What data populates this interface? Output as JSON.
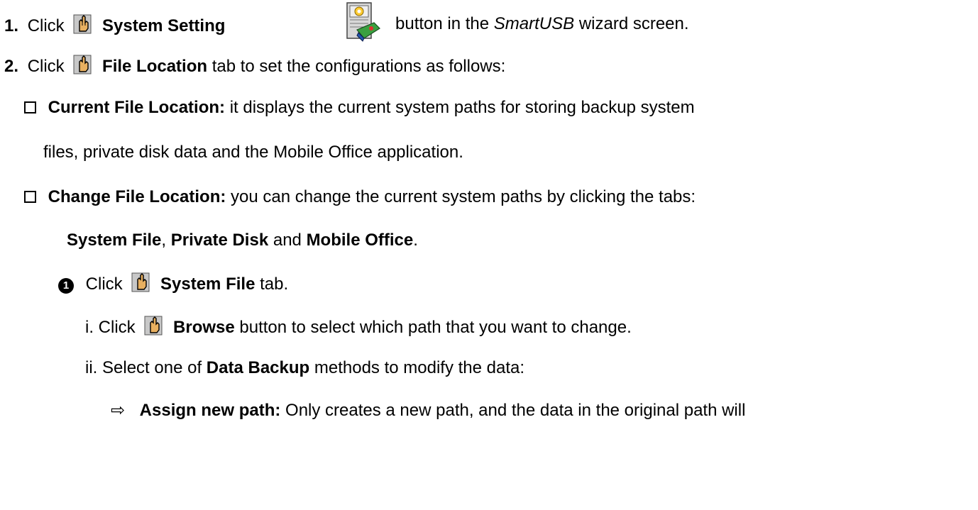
{
  "step1": {
    "num": "1.",
    "click": "Click",
    "bold": "System Setting",
    "rest1": "button in the",
    "italic": "SmartUSB",
    "rest2": "wizard screen."
  },
  "step2": {
    "num": "2.",
    "click": "Click",
    "bold": "File Location",
    "rest": "tab to set the configurations as follows:"
  },
  "current": {
    "bold": "Current File Location:",
    "text1": "it displays the current system paths for storing backup system",
    "text2": "files, private disk data and the Mobile Office application."
  },
  "change": {
    "bold": "Change File Location:",
    "text1": "you can change the current system paths by clicking the tabs:",
    "tab1": "System File",
    "sep1": ",",
    "tab2": "Private Disk",
    "and": "and",
    "tab3": "Mobile Office",
    "end": "."
  },
  "sub1": {
    "marker": "1",
    "click": "Click",
    "bold": "System File",
    "rest": "tab."
  },
  "roman1": {
    "num": "i.",
    "click": "Click",
    "bold": "Browse",
    "rest": "button to select which path that you want to change."
  },
  "roman2": {
    "num": "ii.",
    "pre": "Select one of",
    "bold": "Data Backup",
    "rest": "methods to modify the data:"
  },
  "assign": {
    "arrow": "⇨",
    "bold": "Assign new path:",
    "rest": "Only creates a new path, and the data in the original path will"
  },
  "icons": {
    "hand": "pointing-hand-icon",
    "system_setting": "system-setting-icon"
  }
}
